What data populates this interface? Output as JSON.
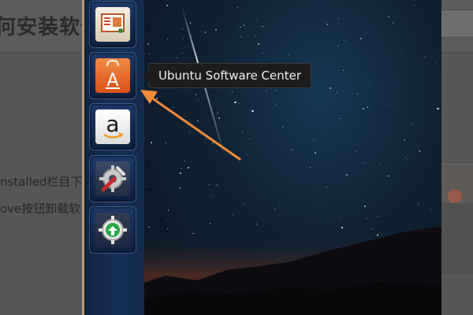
{
  "article": {
    "heading": "何安装软件",
    "line1": "nstalled栏目下",
    "line2": "ove按钮卸载软"
  },
  "launcher": {
    "items": [
      {
        "name": "libreoffice-impress",
        "icon": "presentation-icon"
      },
      {
        "name": "ubuntu-software-center",
        "icon": "shopping-bag-icon",
        "label": "A"
      },
      {
        "name": "amazon",
        "icon": "amazon-icon",
        "label": "a"
      },
      {
        "name": "system-settings",
        "icon": "wrench-gear-icon"
      },
      {
        "name": "update-manager",
        "icon": "update-arrow-icon"
      }
    ]
  },
  "tooltip": {
    "text": "Ubuntu Software Center"
  },
  "colors": {
    "annotation_arrow": "#f08a3a",
    "software_center": "#e8652a",
    "launcher_border": "#b89a6a"
  }
}
